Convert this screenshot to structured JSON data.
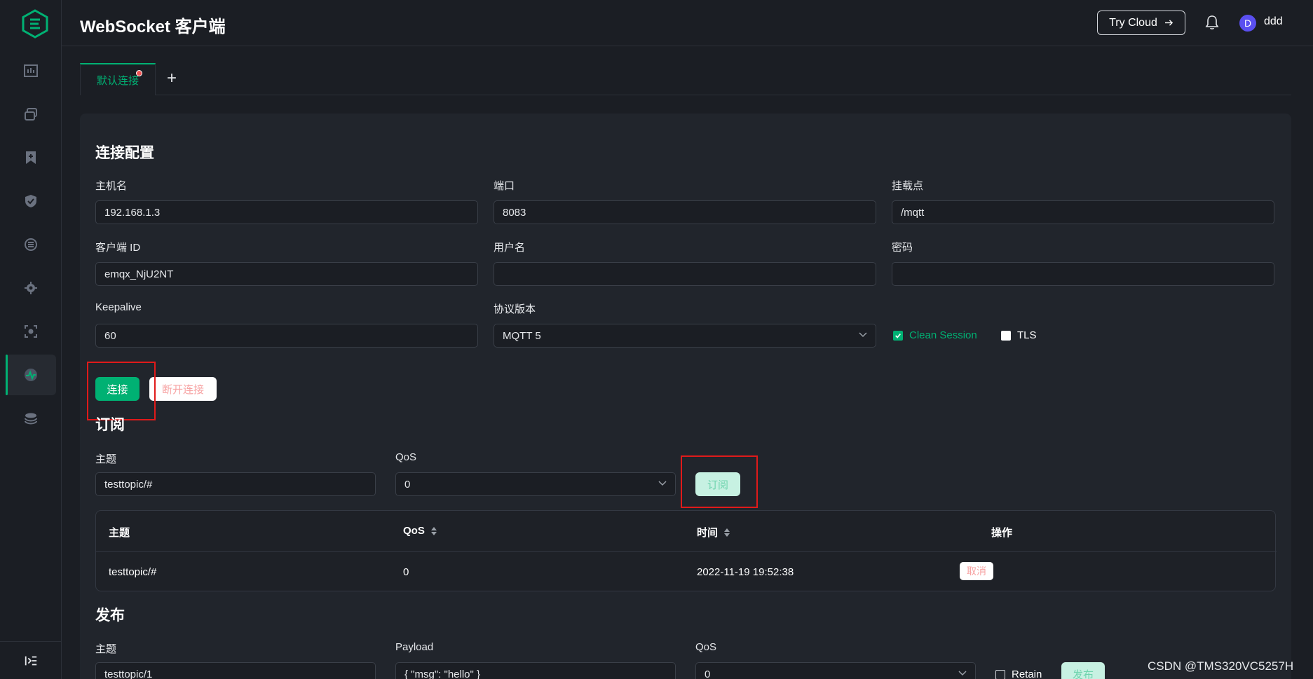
{
  "header": {
    "title": "WebSocket 客户端",
    "try_cloud": "Try Cloud",
    "avatar_initial": "D",
    "username": "ddd"
  },
  "tabs": {
    "active_label": "默认连接",
    "add_symbol": "+"
  },
  "config": {
    "title": "连接配置",
    "host_label": "主机名",
    "host_value": "192.168.1.3",
    "port_label": "端口",
    "port_value": "8083",
    "path_label": "挂载点",
    "path_value": "/mqtt",
    "client_id_label": "客户端 ID",
    "client_id_value": "emqx_NjU2NT",
    "username_label": "用户名",
    "username_value": "",
    "password_label": "密码",
    "password_value": "",
    "keepalive_label": "Keepalive",
    "keepalive_value": "60",
    "protocol_label": "协议版本",
    "protocol_value": "MQTT 5",
    "clean_session_label": "Clean Session",
    "clean_session_checked": true,
    "tls_label": "TLS",
    "tls_checked": false,
    "connect_button": "连接",
    "disconnect_button": "断开连接"
  },
  "subscribe": {
    "title": "订阅",
    "topic_label": "主题",
    "topic_value": "testtopic/#",
    "qos_label": "QoS",
    "qos_value": "0",
    "subscribe_button": "订阅",
    "table": {
      "headers": [
        "主题",
        "QoS",
        "时间",
        "操作"
      ],
      "rows": [
        {
          "topic": "testtopic/#",
          "qos": "0",
          "time": "2022-11-19 19:52:38",
          "action": "取消"
        }
      ]
    }
  },
  "publish": {
    "title": "发布",
    "topic_label": "主题",
    "topic_value": "testtopic/1",
    "payload_label": "Payload",
    "payload_value": "{ \"msg\": \"hello\" }",
    "qos_label": "QoS",
    "qos_value": "0",
    "retain_label": "Retain",
    "publish_button": "发布"
  },
  "watermark": "CSDN @TMS320VC5257H",
  "colors": {
    "accent": "#00b173",
    "background": "#1b1e24",
    "panel": "#21252c",
    "annotation": "#e01a1a"
  }
}
